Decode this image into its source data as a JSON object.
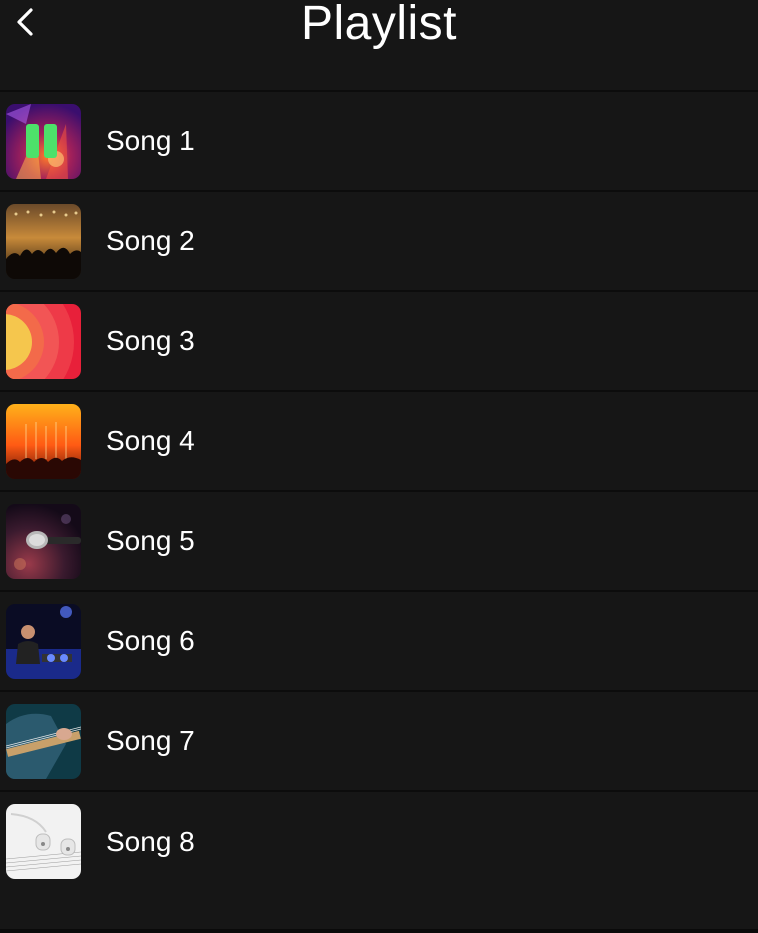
{
  "header": {
    "title": "Playlist",
    "back_icon": "chevron-left-icon"
  },
  "playlist": {
    "songs": [
      {
        "label": "Song 1",
        "playing": true,
        "art": "concert-purple-orange"
      },
      {
        "label": "Song 2",
        "art": "crowd-stage-lights"
      },
      {
        "label": "Song 3",
        "art": "red-circles-abstract"
      },
      {
        "label": "Song 4",
        "art": "orange-concert-crowd"
      },
      {
        "label": "Song 5",
        "art": "microphone-closeup"
      },
      {
        "label": "Song 6",
        "art": "dj-turntables"
      },
      {
        "label": "Song 7",
        "art": "guitar-player"
      },
      {
        "label": "Song 8",
        "art": "earbuds-sheet-music"
      }
    ]
  },
  "colors": {
    "background": "#161616",
    "divider": "#0c0c0c",
    "text": "#ffffff",
    "pause_accent": "#4de16a"
  }
}
